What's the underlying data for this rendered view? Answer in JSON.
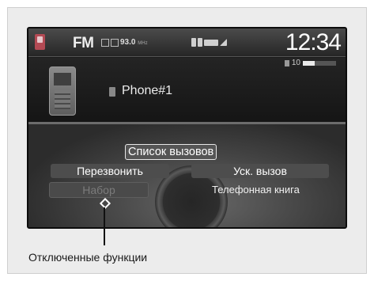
{
  "status_bar": {
    "source": "FM",
    "frequency": "93.0",
    "frequency_unit": "MHz",
    "clock": "12:34",
    "volume_level": "10",
    "volume_fraction": 0.35
  },
  "phone": {
    "device_name": "Phone#1"
  },
  "menu": {
    "call_list": "Список вызовов",
    "redial": "Перезвонить",
    "speed_dial": "Уск. вызов",
    "dial": "Набор",
    "phonebook": "Телефонная книга"
  },
  "caption": {
    "text": "Отключенные функции"
  },
  "colors": {
    "screen_bg": "#1b1b1b",
    "frame_bg": "#ececec",
    "disabled_text": "#7b7b7b"
  }
}
